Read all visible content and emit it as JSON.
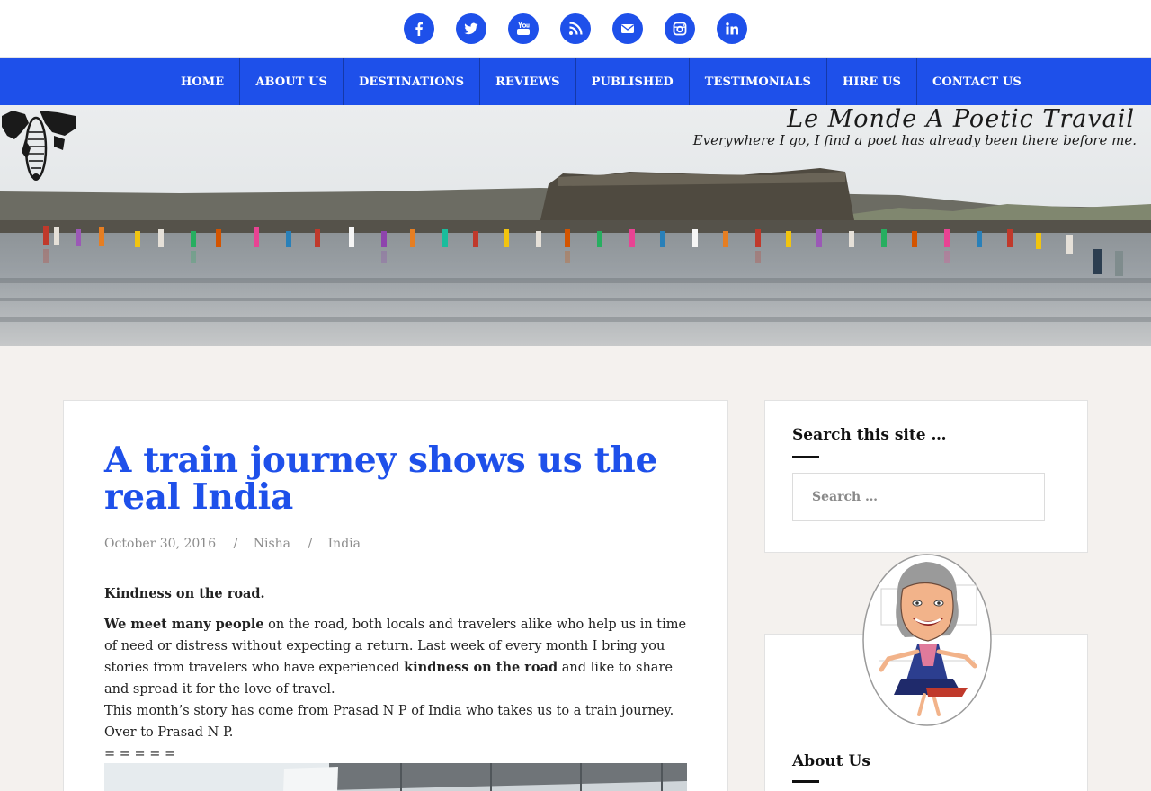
{
  "social": {
    "icons": [
      "facebook-icon",
      "twitter-icon",
      "youtube-icon",
      "rss-icon",
      "email-icon",
      "instagram-icon",
      "linkedin-icon"
    ],
    "icon_color": "#ffffff",
    "badge_color": "#1e50ea"
  },
  "nav": {
    "items": [
      "HOME",
      "ABOUT US",
      "DESTINATIONS",
      "REVIEWS",
      "PUBLISHED",
      "TESTIMONIALS",
      "HIRE US",
      "CONTACT US"
    ],
    "background": "#1e50ea"
  },
  "hero": {
    "site_title": "Le Monde A Poetic Travail",
    "tagline": "Everywhere I go, I find a poet has already been there before me."
  },
  "post": {
    "title": "A train journey shows us the real India",
    "date": "October 30, 2016",
    "author": "Nisha",
    "category": "India",
    "meta_separator": "/",
    "heading": "Kindness on the road.",
    "para1_bold_lead": "We meet many people",
    "para1_text_a": " on the road, both locals and travelers alike who help us in time of need or distress without expecting a return. Last week of every month I bring you stories from travelers who have experienced ",
    "para1_bold_mid": "kindness on the road",
    "para1_text_b": " and like to share and spread it for the love of travel.",
    "para2": "This month’s story has come from Prasad N P of India who takes us to a train journey. Over to Prasad N P.",
    "divider": "= = = = ="
  },
  "sidebar": {
    "search_title": "Search this site …",
    "search_placeholder": "Search …",
    "about_title": "About Us"
  },
  "colors": {
    "accent": "#1e50ea",
    "page_background": "#f4f1ee"
  }
}
